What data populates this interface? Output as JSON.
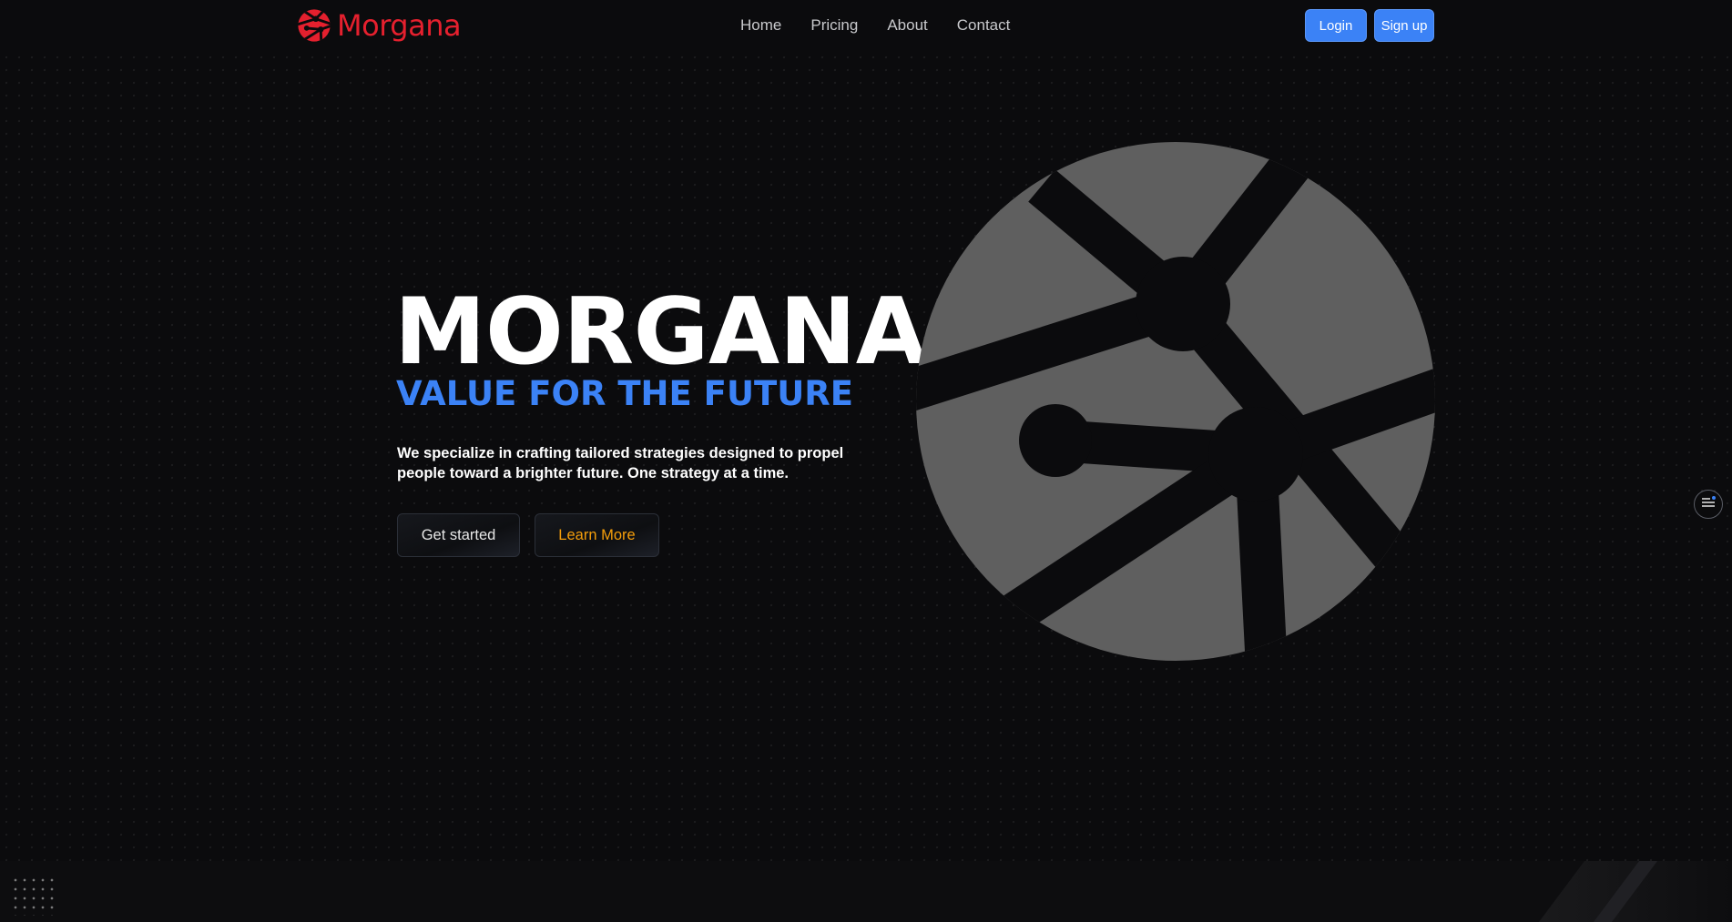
{
  "header": {
    "logo_text": "Morgana",
    "nav": [
      "Home",
      "Pricing",
      "About",
      "Contact"
    ],
    "login_label": "Login",
    "signup_label": "Sign up"
  },
  "hero": {
    "title": "MORGANA",
    "subtitle": "VALUE FOR THE FUTURE",
    "description_line1": "We specialize in crafting tailored strategies designed to propel",
    "description_line2": "people toward a brighter future. One strategy at a time.",
    "primary_button": "Get started",
    "secondary_button": "Learn More"
  },
  "colors": {
    "background": "#0b0b0d",
    "brand": "#e5202e",
    "accent": "#3b82f6",
    "learn_more": "#f59e0b",
    "graphic": "#5f5f5f"
  },
  "icons": {
    "logo": "morgana-logo-icon",
    "hero_graphic": "morgana-emblem-icon",
    "side_widget": "menu-lines-icon"
  }
}
